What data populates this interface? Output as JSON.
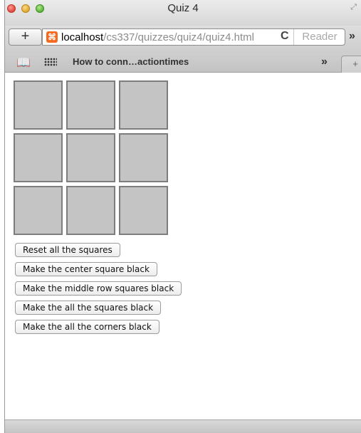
{
  "window": {
    "title": "Quiz 4"
  },
  "toolbar": {
    "add_label": "+",
    "url_host": "localhost",
    "url_path": "/cs337/quizzes/quiz4/quiz4.html",
    "reload_icon": "C",
    "reader_label": "Reader",
    "more_icon": "»"
  },
  "bookmarks": {
    "book_icon": "⌧",
    "items": [
      {
        "label": "How to conn…actiontimes"
      }
    ],
    "more_icon": "»",
    "newtab_label": "+"
  },
  "quiz": {
    "squares": [
      {
        "id": "top-left",
        "color": "#c4c4c4"
      },
      {
        "id": "top-center",
        "color": "#c4c4c4"
      },
      {
        "id": "top-right",
        "color": "#c4c4c4"
      },
      {
        "id": "middle-left",
        "color": "#c4c4c4"
      },
      {
        "id": "center",
        "color": "#c4c4c4"
      },
      {
        "id": "middle-right",
        "color": "#c4c4c4"
      },
      {
        "id": "bottom-left",
        "color": "#c4c4c4"
      },
      {
        "id": "bottom-center",
        "color": "#c4c4c4"
      },
      {
        "id": "bottom-right",
        "color": "#c4c4c4"
      }
    ],
    "buttons": [
      {
        "label": "Reset all the squares"
      },
      {
        "label": "Make the center square black"
      },
      {
        "label": "Make the middle row squares black"
      },
      {
        "label": "Make the all the squares black"
      },
      {
        "label": "Make the all the corners black"
      }
    ]
  }
}
